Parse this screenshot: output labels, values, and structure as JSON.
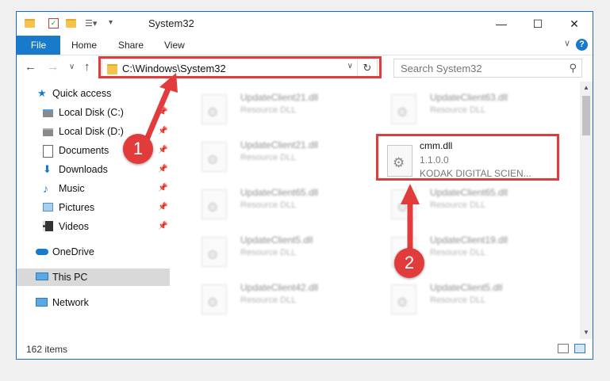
{
  "window": {
    "title": "System32",
    "min_glyph": "—",
    "max_glyph": "☐",
    "close_glyph": "✕"
  },
  "ribbon": {
    "tabs": [
      "File",
      "Home",
      "Share",
      "View"
    ],
    "help_glyph": "?",
    "collapse_glyph": "∨"
  },
  "nav": {
    "back": "←",
    "forward": "→",
    "recent": "∨",
    "up": "↑",
    "address": "C:\\Windows\\System32",
    "address_drop": "∨",
    "refresh": "↻",
    "search_placeholder": "Search System32",
    "search_icon": "⚲"
  },
  "sidebar": {
    "items": [
      {
        "label": "Quick access",
        "icon": "star-icon"
      },
      {
        "label": "Local Disk (C:)",
        "icon": "drive-icon",
        "pinned": true
      },
      {
        "label": "Local Disk (D:)",
        "icon": "drive-icon",
        "pinned": true
      },
      {
        "label": "Documents",
        "icon": "documents-icon",
        "pinned": true
      },
      {
        "label": "Downloads",
        "icon": "downloads-icon",
        "pinned": true
      },
      {
        "label": "Music",
        "icon": "music-icon",
        "pinned": true
      },
      {
        "label": "Pictures",
        "icon": "pictures-icon",
        "pinned": true
      },
      {
        "label": "Videos",
        "icon": "videos-icon",
        "pinned": true
      },
      {
        "label": "OneDrive",
        "icon": "cloud-icon"
      },
      {
        "label": "This PC",
        "icon": "computer-icon",
        "selected": true
      },
      {
        "label": "Network",
        "icon": "network-icon"
      }
    ],
    "pin_glyph": "📌"
  },
  "files": {
    "left": [
      {
        "name": "UpdateClient21.dll",
        "type": "Resource DLL"
      },
      {
        "name": "UpdateClient21.dll",
        "type": "Resource DLL"
      },
      {
        "name": "UpdateClient65.dll",
        "type": "Resource DLL"
      },
      {
        "name": "UpdateClient5.dll",
        "type": "Resource DLL"
      },
      {
        "name": "UpdateClient42.dll",
        "type": "Resource DLL"
      }
    ],
    "right": [
      {
        "name": "UpdateClient63.dll",
        "type": "Resource DLL"
      },
      {
        "name": "UpdateClient65.dll",
        "type": "Resource DLL"
      },
      {
        "name": "UpdateClient19.dll",
        "type": "Resource DLL"
      },
      {
        "name": "UpdateClient5.dll",
        "type": "Resource DLL"
      }
    ],
    "highlighted": {
      "name": "cmm.dll",
      "version": "1.1.0.0",
      "company": "KODAK DIGITAL SCIEN..."
    }
  },
  "status": {
    "count": "162 items"
  },
  "annotations": {
    "marker1": "1",
    "marker2": "2",
    "color": "#e23b3b"
  }
}
